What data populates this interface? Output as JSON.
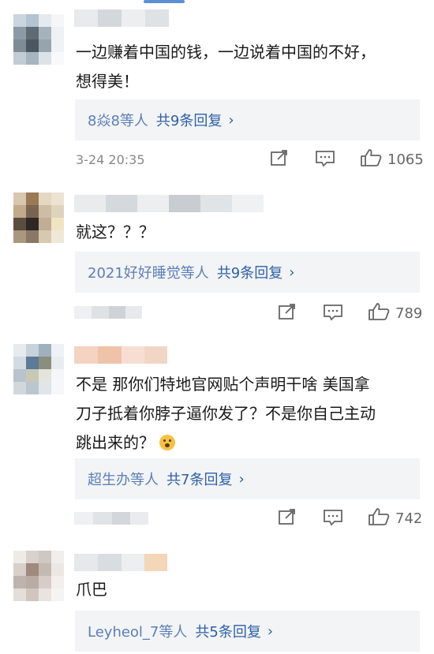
{
  "comments": [
    {
      "text": "一边赚着中国的钱，一边说着中国的不好，\n想得美！",
      "reply_users": "8焱8等人",
      "reply_count": "共9条回复",
      "time": "3-24 20:35",
      "likes": "1065"
    },
    {
      "text": "就这？？？",
      "reply_users": "2021好好睡觉等人",
      "reply_count": "共9条回复",
      "time": "",
      "likes": "789"
    },
    {
      "text": "不是 那你们特地官网贴个声明干啥 美国拿\n刀子抵着你脖子逼你发了？不是你自己主动\n跳出来的？",
      "reply_users": "超生办等人",
      "reply_count": "共7条回复",
      "time": "",
      "likes": "742"
    },
    {
      "text": "爪巴",
      "reply_users": "Leyheol_7等人",
      "reply_count": "共5条回复",
      "time": "",
      "likes": ""
    }
  ],
  "icons": {
    "share": "share-icon",
    "comment": "comment-icon",
    "like": "thumbs-up-icon",
    "reply_arrow": "chevron-right-icon"
  },
  "colors": {
    "link": "#5b7fb7",
    "reply_bg": "#f3f4f6",
    "meta": "#888888"
  }
}
